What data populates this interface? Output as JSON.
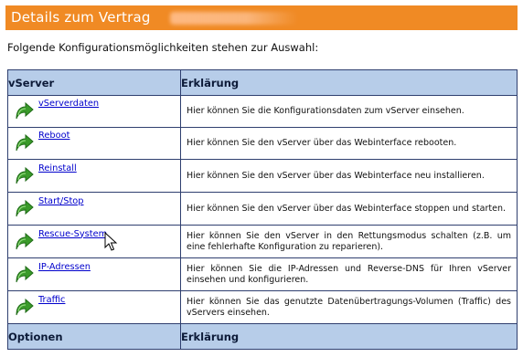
{
  "header": {
    "title": "Details zum Vertrag"
  },
  "intro": "Folgende Konfigurationsmöglichkeiten stehen zur Auswahl:",
  "table": {
    "col1": "vServer",
    "col2": "Erklärung",
    "rows": [
      {
        "link": "vServerdaten",
        "desc": "Hier können Sie die Konfigurationsdaten zum vServer einsehen."
      },
      {
        "link": "Reboot",
        "desc": "Hier können Sie den vServer über das Webinterface rebooten."
      },
      {
        "link": "Reinstall",
        "desc": "Hier können Sie den vServer über das Webinterface neu installieren."
      },
      {
        "link": "Start/Stop",
        "desc": "Hier können Sie den vServer über das Webinterface stoppen und starten."
      },
      {
        "link": "Rescue-System",
        "desc": "Hier können Sie den vServer in den Rettungsmodus schalten (z.B. um eine fehlerhafte Konfiguration zu reparieren)."
      },
      {
        "link": "IP-Adressen",
        "desc": "Hier können Sie die IP-Adressen und Reverse-DNS für Ihren vServer einsehen und konfigurieren."
      },
      {
        "link": "Traffic",
        "desc": "Hier können Sie das genutzte Datenübertragungs-Volumen (Traffic) des vServers einsehen."
      }
    ],
    "footer_col1": "Optionen",
    "footer_col2": "Erklärung"
  },
  "colors": {
    "title_bar": "#f08a24",
    "table_header": "#b7cde9",
    "link": "#0000cc",
    "arrow": "#3a9a2a"
  },
  "icons": {
    "row_icon": "green-arrow-icon",
    "pointer": "mouse-pointer-icon"
  }
}
